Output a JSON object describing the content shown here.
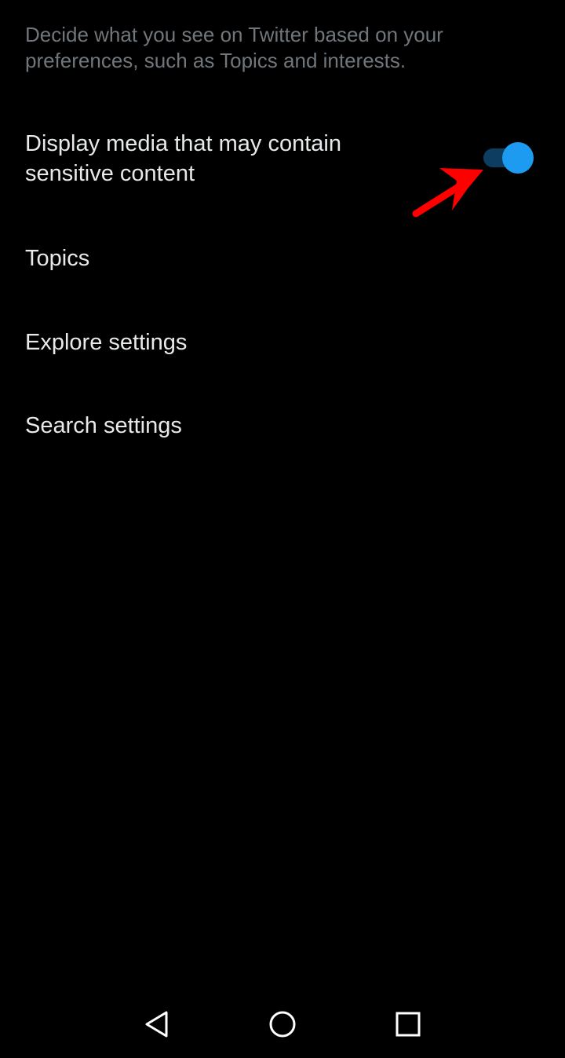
{
  "settings": {
    "description": "Decide what you see on Twitter based on your preferences, such as Topics and interests.",
    "sensitive_media": {
      "label": "Display media that may contain sensitive content",
      "enabled": true
    },
    "items": [
      {
        "label": "Topics"
      },
      {
        "label": "Explore settings"
      },
      {
        "label": "Search settings"
      }
    ]
  },
  "annotation": {
    "type": "arrow",
    "color": "#ff0000",
    "points_to": "sensitive-media-toggle"
  },
  "navbar": {
    "back_icon": "triangle-back-icon",
    "home_icon": "circle-home-icon",
    "recents_icon": "square-recents-icon"
  },
  "colors": {
    "background": "#000000",
    "primary_text": "#e7e9ea",
    "secondary_text": "#71767b",
    "toggle_thumb": "#1d9bf0",
    "toggle_track": "#0d3d61"
  }
}
